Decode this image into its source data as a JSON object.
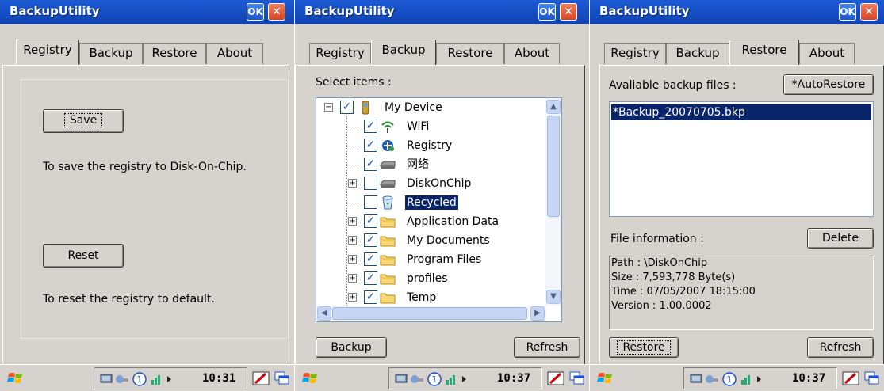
{
  "app": {
    "title": "BackupUtility",
    "ok_label": "OK",
    "close_glyph": "✕"
  },
  "tabs": [
    "Registry",
    "Backup",
    "Restore",
    "About"
  ],
  "registry": {
    "save_label": "Save",
    "save_desc": "To save the registry to Disk-On-Chip.",
    "reset_label": "Reset",
    "reset_desc": "To reset the registry to default."
  },
  "backup": {
    "select_label": "Select items :",
    "tree": [
      {
        "label": "My Device",
        "checked": true,
        "icon": "device-icon"
      },
      {
        "label": "WiFi",
        "checked": true,
        "icon": "wifi-icon"
      },
      {
        "label": "Registry",
        "checked": true,
        "icon": "registry-icon"
      },
      {
        "label": "网络",
        "checked": true,
        "icon": "drive-icon"
      },
      {
        "label": "DiskOnChip",
        "checked": false,
        "icon": "drive-icon"
      },
      {
        "label": "Recycled",
        "checked": false,
        "icon": "recycle-bin-icon"
      },
      {
        "label": "Application Data",
        "checked": true,
        "icon": "folder-icon"
      },
      {
        "label": "My Documents",
        "checked": true,
        "icon": "folder-icon"
      },
      {
        "label": "Program Files",
        "checked": true,
        "icon": "folder-icon"
      },
      {
        "label": "profiles",
        "checked": true,
        "icon": "folder-icon"
      },
      {
        "label": "Temp",
        "checked": true,
        "icon": "folder-icon"
      }
    ],
    "backup_label": "Backup",
    "refresh_label": "Refresh"
  },
  "restore": {
    "available_label": "Avaliable backup files :",
    "autorestore_label": "*AutoRestore",
    "files": [
      "*Backup_20070705.bkp"
    ],
    "fileinfo_label": "File information :",
    "delete_label": "Delete",
    "info": [
      "Path : \\DiskOnChip",
      "Size : 7,593,778 Byte(s)",
      "Time : 07/05/2007 18:15:00",
      "Version : 1.00.0002"
    ],
    "restore_label": "Restore",
    "refresh_label": "Refresh"
  },
  "taskbar": {
    "times": [
      "10:31",
      "10:37",
      "10:37"
    ]
  },
  "colors": {
    "title_bar": "#1c5ad4",
    "selection": "#0a246a",
    "window_bg": "#d6d3ce",
    "check": "#2150c8"
  }
}
